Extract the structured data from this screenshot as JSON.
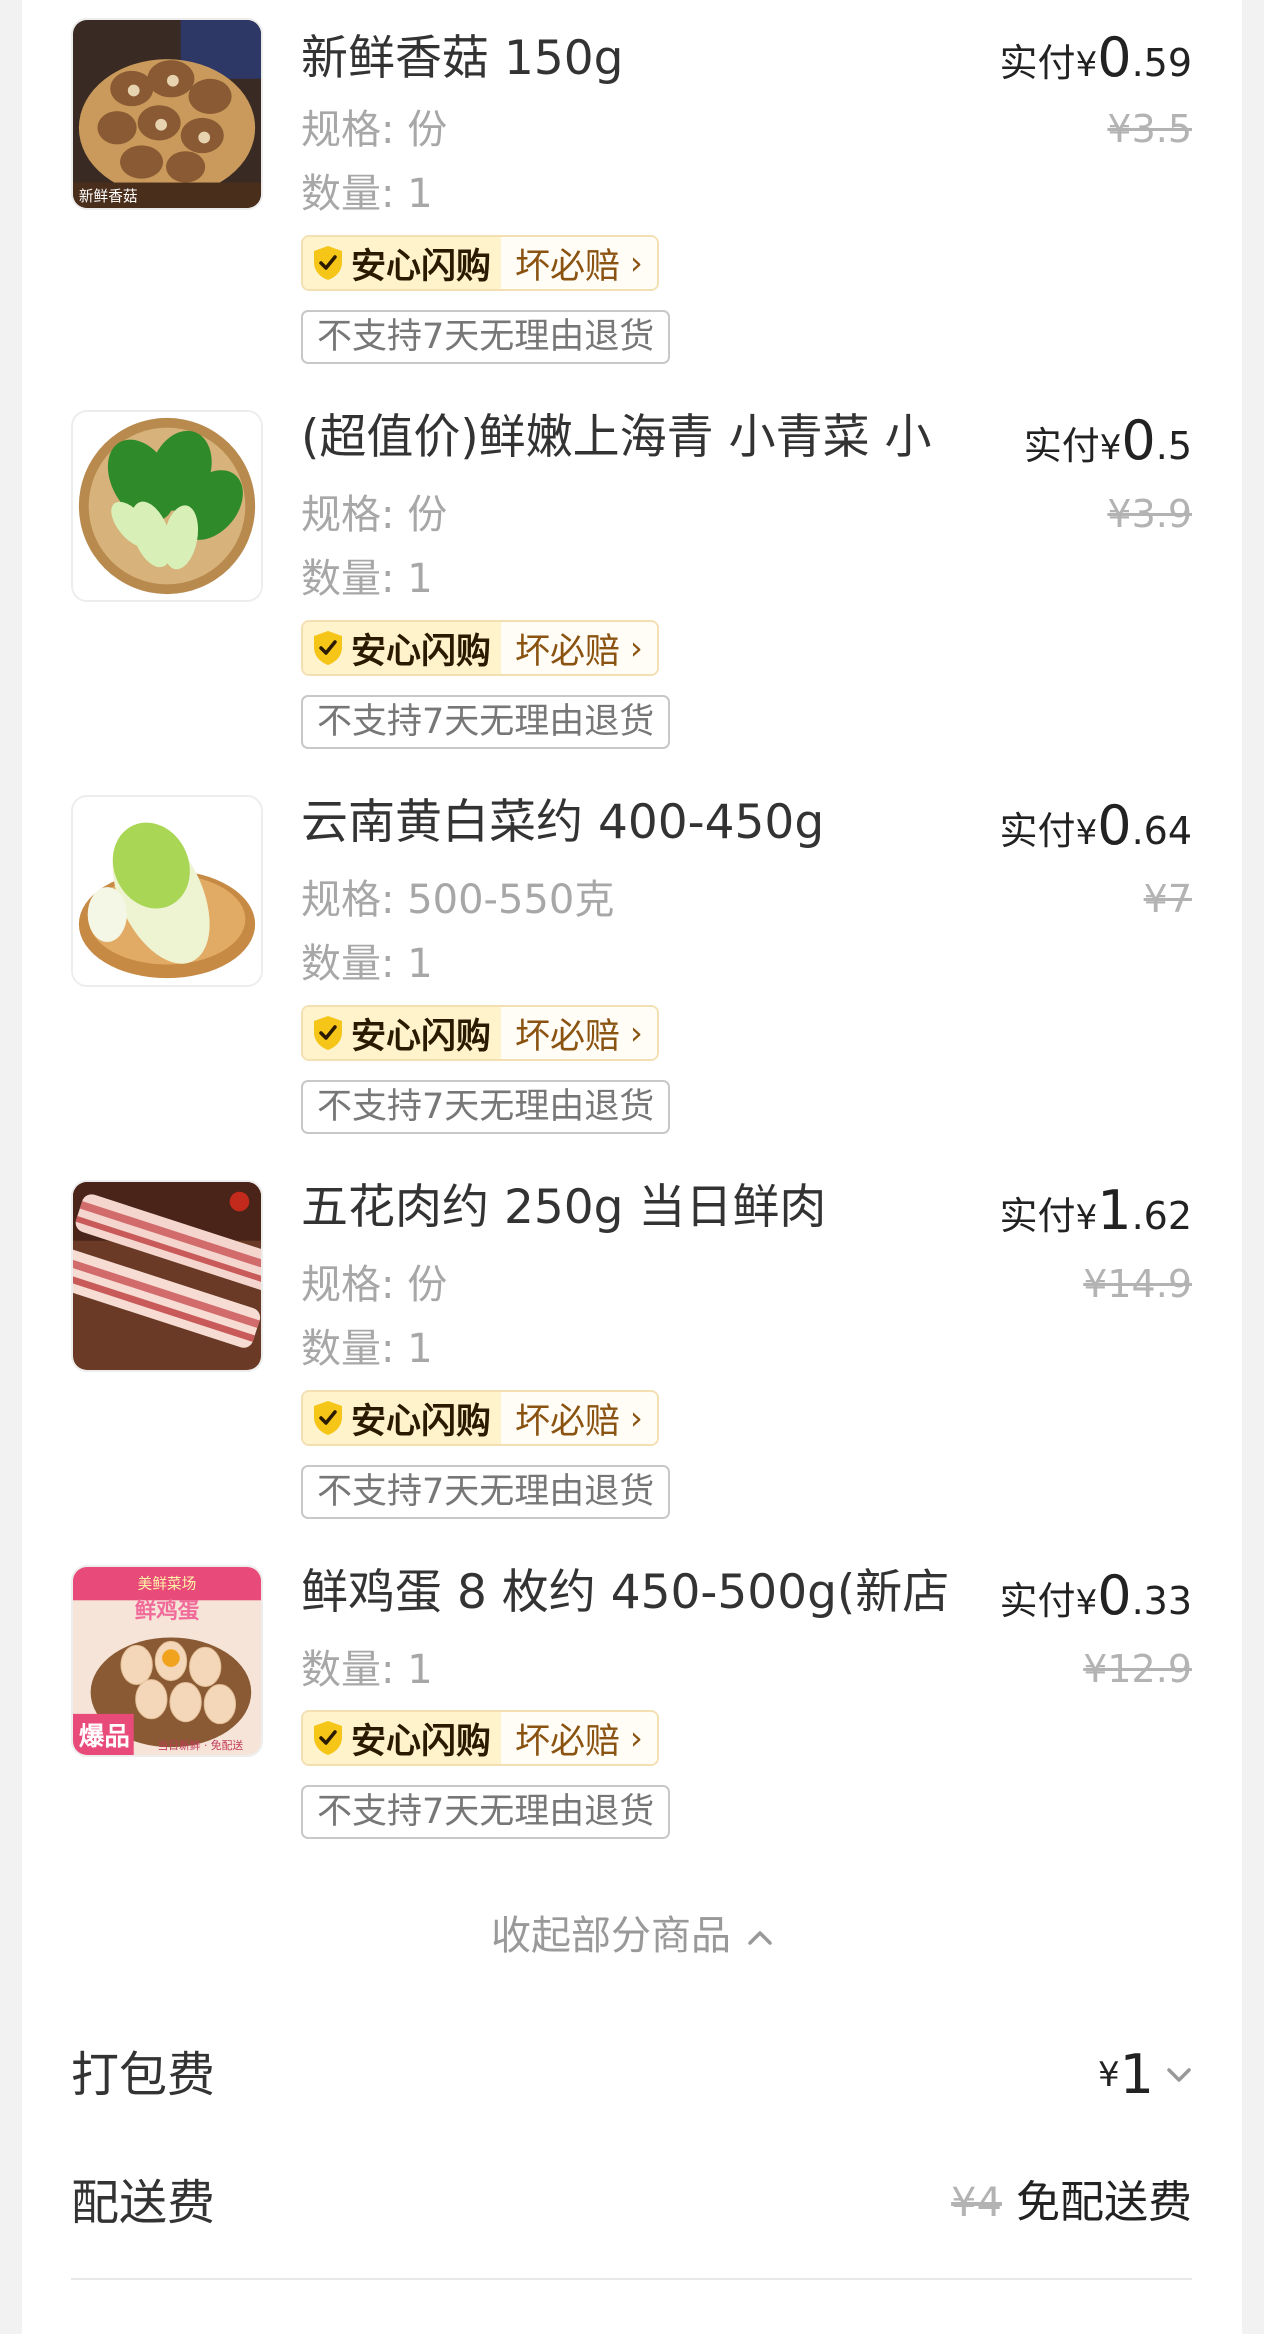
{
  "items": [
    {
      "title": "新鲜香菇 150g",
      "spec": "规格: 份",
      "qty": "数量: 1",
      "pay_label": "实付",
      "pay_yen": "¥",
      "pay_int": "0",
      "pay_dec": ".59",
      "orig": "¥3.5",
      "image": "mushroom"
    },
    {
      "title": "(超值价)鲜嫩上海青 小青菜 小",
      "spec": "规格: 份",
      "qty": "数量: 1",
      "pay_label": "实付",
      "pay_yen": "¥",
      "pay_int": "0",
      "pay_dec": ".5",
      "orig": "¥3.9",
      "image": "bok-choy"
    },
    {
      "title": "云南黄白菜约 400-450g",
      "spec": "规格: 500-550克",
      "qty": "数量: 1",
      "pay_label": "实付",
      "pay_yen": "¥",
      "pay_int": "0",
      "pay_dec": ".64",
      "orig": "¥7",
      "image": "cabbage"
    },
    {
      "title": "五花肉约 250g 当日鲜肉",
      "spec": "规格: 份",
      "qty": "数量: 1",
      "pay_label": "实付",
      "pay_yen": "¥",
      "pay_int": "1",
      "pay_dec": ".62",
      "orig": "¥14.9",
      "image": "pork-belly"
    },
    {
      "title": "鲜鸡蛋 8 枚约 450-500g(新店",
      "spec": null,
      "qty": "数量: 1",
      "pay_label": "实付",
      "pay_yen": "¥",
      "pay_int": "0",
      "pay_dec": ".33",
      "orig": "¥12.9",
      "image": "eggs",
      "image_text": {
        "top": "美鲜菜场",
        "big": "鲜鸡蛋",
        "side": "爆品",
        "bottom": "当日新鲜 · 免配送"
      }
    }
  ],
  "badge": {
    "left": "安心闪购",
    "right": "坏必赔"
  },
  "no_return_tag": "不支持7天无理由退货",
  "collapse_label": "收起部分商品",
  "packing_fee": {
    "label": "打包费",
    "yen": "¥",
    "value": "1"
  },
  "delivery_fee": {
    "label": "配送费",
    "original": "¥4",
    "value": "免配送费"
  },
  "thumb_text": {
    "mushroom": "新鲜香菇"
  },
  "colors": {
    "badge_bg": "#fff3cc",
    "badge_text_right": "#8a5311",
    "shield": "#f5c518"
  }
}
